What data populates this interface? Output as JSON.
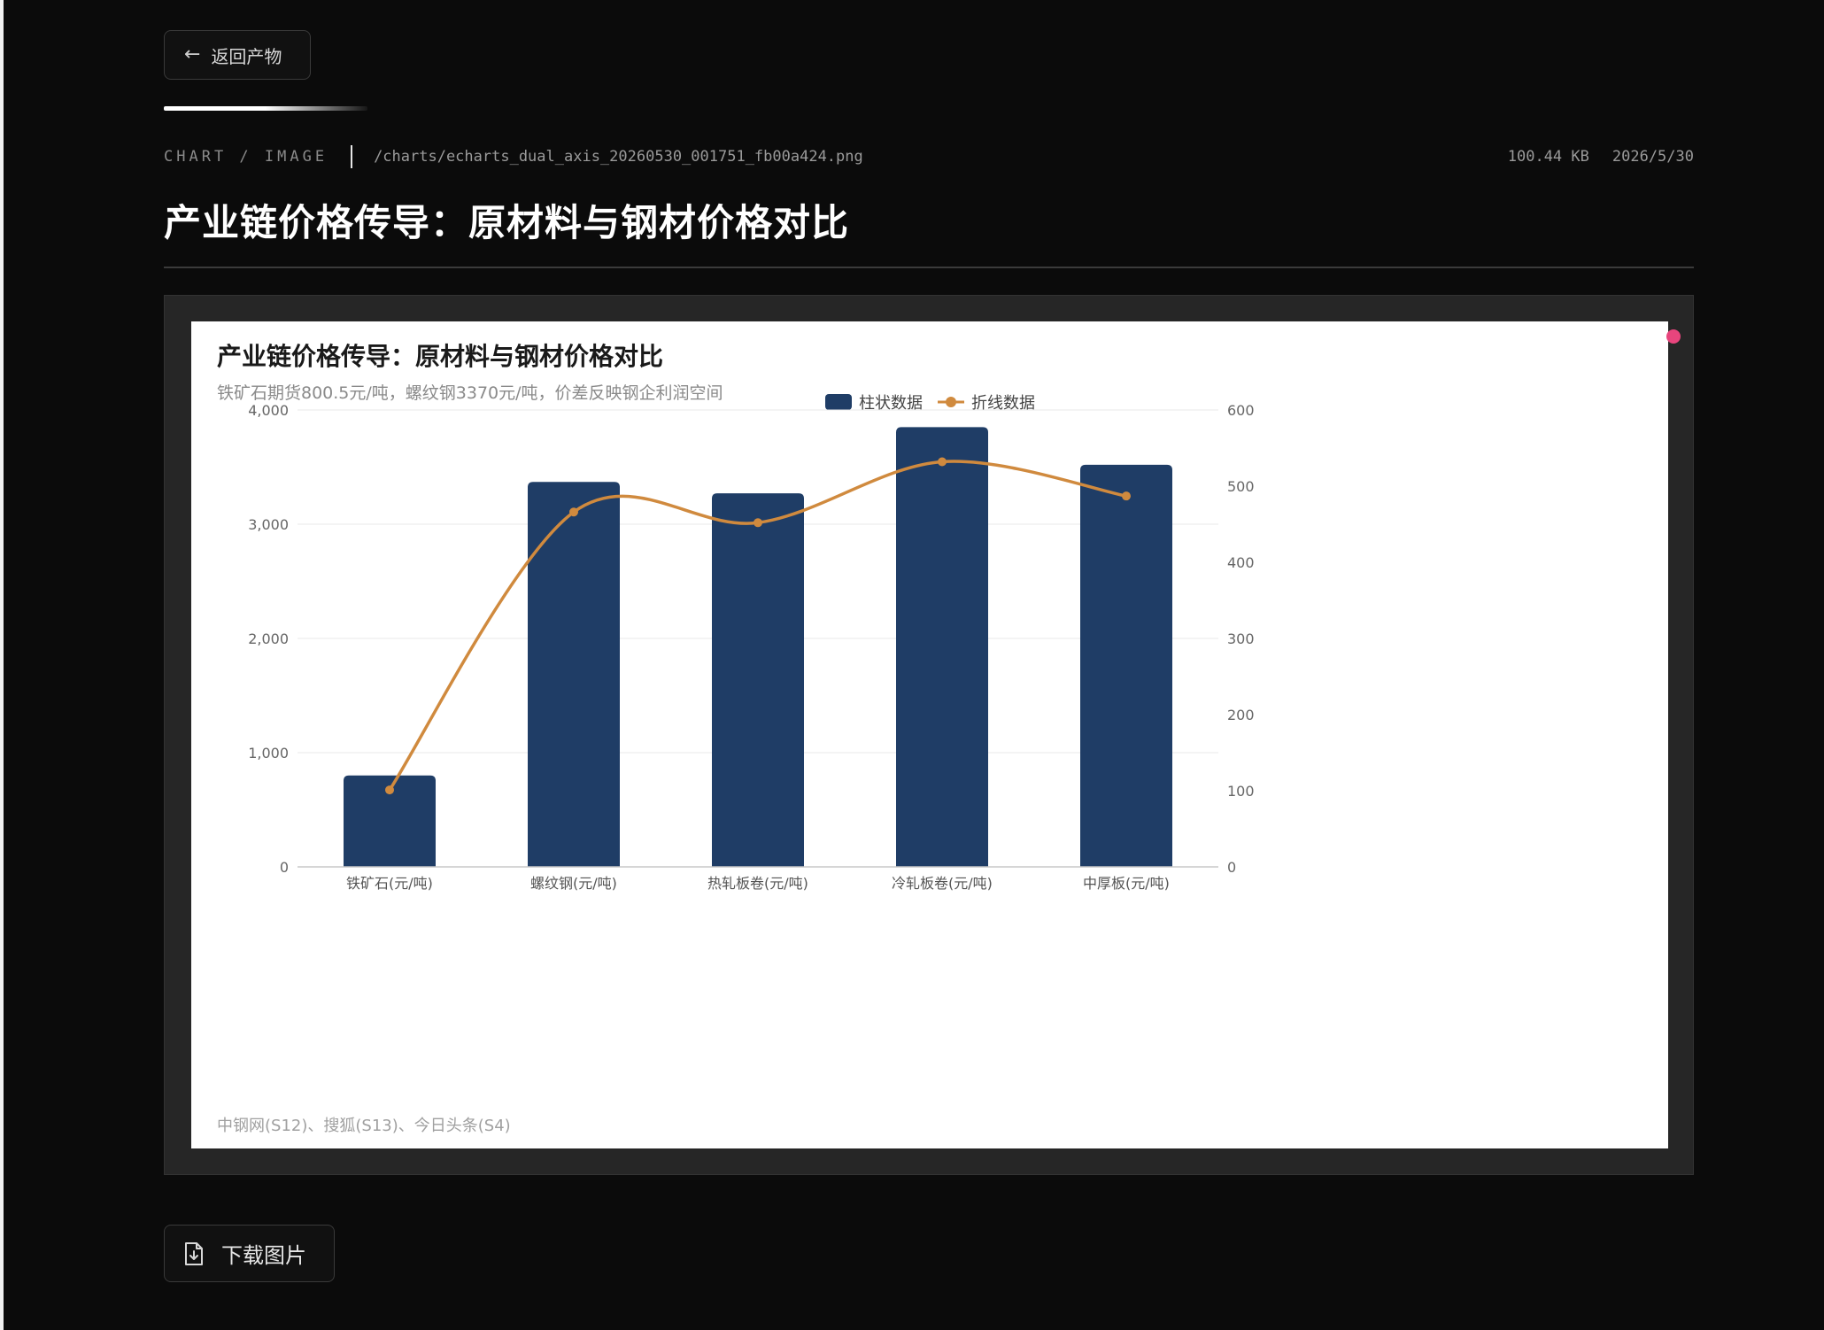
{
  "nav": {
    "back_label": "返回产物",
    "back_icon": "arrow-left-icon"
  },
  "meta": {
    "kind": "CHART / IMAGE",
    "path": "/charts/echarts_dual_axis_20260530_001751_fb00a424.png",
    "size": "100.44 KB",
    "date": "2026/5/30"
  },
  "page_title": "产业链价格传导：原材料与钢材价格对比",
  "actions": {
    "download_label": "下载图片",
    "download_icon": "file-download-icon"
  },
  "colors": {
    "bar": "#1f3d66",
    "line": "#d08a3e",
    "accent_dot": "#e8457d"
  },
  "chart_data": {
    "type": "bar",
    "title": "产业链价格传导：原材料与钢材价格对比",
    "subtitle": "铁矿石期货800.5元/吨，螺纹钢3370元/吨，价差反映钢企利润空间",
    "source": "中钢网(S12)、搜狐(S13)、今日头条(S4)",
    "categories": [
      "铁矿石(元/吨)",
      "螺纹钢(元/吨)",
      "热轧板卷(元/吨)",
      "冷轧板卷(元/吨)",
      "中厚板(元/吨)"
    ],
    "series": [
      {
        "name": "柱状数据",
        "type": "bar",
        "axis": "left",
        "values": [
          800.5,
          3370,
          3270,
          3850,
          3520
        ]
      },
      {
        "name": "折线数据",
        "type": "line",
        "axis": "right",
        "smooth": true,
        "values": [
          101,
          466,
          452,
          532,
          487
        ]
      }
    ],
    "y_left": {
      "min": 0,
      "max": 4000,
      "ticks": [
        "0",
        "1,000",
        "2,000",
        "3,000",
        "4,000"
      ]
    },
    "y_right": {
      "min": 0,
      "max": 600,
      "ticks": [
        "0",
        "100",
        "200",
        "300",
        "400",
        "500",
        "600"
      ]
    },
    "legend_position": "top-center",
    "grid": true
  }
}
